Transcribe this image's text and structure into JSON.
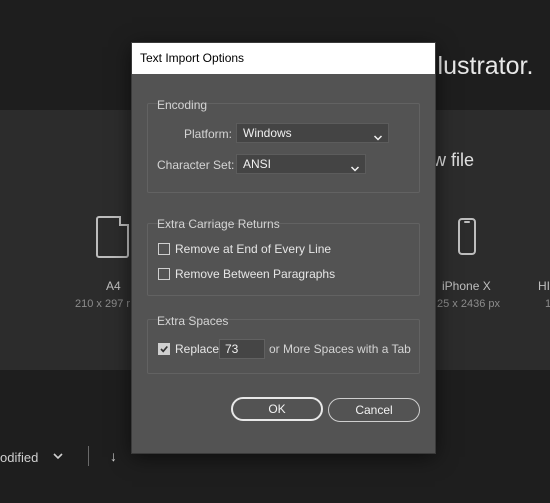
{
  "background": {
    "app_title_fragment": "llustrator.",
    "new_file_fragment": "w file",
    "presets": [
      {
        "name": "A4",
        "size": "210 x 297 r",
        "icon": "document-icon"
      },
      {
        "name": "iPhone X",
        "size": "25 x 2436 px",
        "icon": "phone-icon"
      },
      {
        "name": "HI",
        "size": "1"
      }
    ],
    "sort_label": "odified",
    "sort_arrow": "↓"
  },
  "dialog": {
    "title": "Text Import Options",
    "encoding": {
      "title": "Encoding",
      "platform_label": "Platform:",
      "platform_value": "Windows",
      "charset_label": "Character Set:",
      "charset_value": "ANSI"
    },
    "extra_returns": {
      "title": "Extra Carriage Returns",
      "remove_end_line": {
        "label": "Remove at End of Every Line",
        "checked": false
      },
      "remove_paragraphs": {
        "label": "Remove Between Paragraphs",
        "checked": false
      }
    },
    "extra_spaces": {
      "title": "Extra Spaces",
      "replace": {
        "label": "Replace",
        "checked": true
      },
      "count": "73",
      "suffix": "or More Spaces with a Tab"
    },
    "ok_label": "OK",
    "cancel_label": "Cancel"
  },
  "colors": {
    "dialog_bg": "#535353",
    "page_bg": "#1e1e1e"
  }
}
